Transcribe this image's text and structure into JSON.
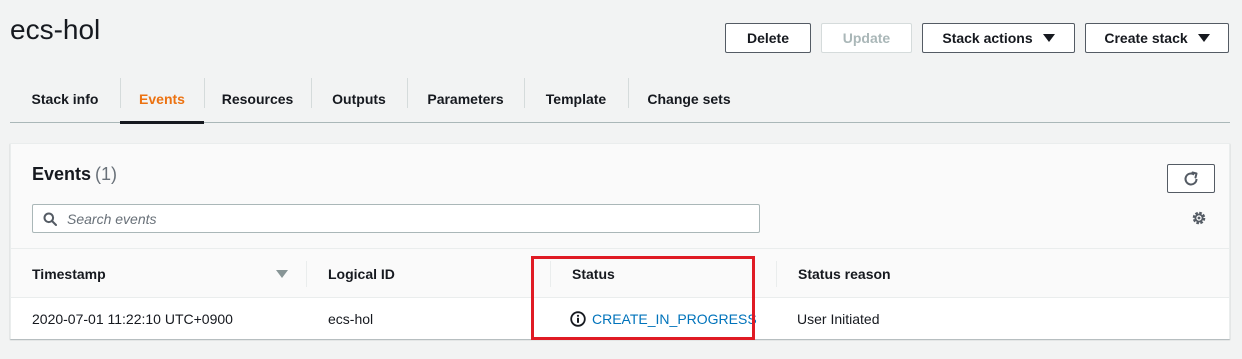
{
  "header": {
    "title": "ecs-hol",
    "buttons": {
      "delete": "Delete",
      "update": "Update",
      "stack_actions": "Stack actions",
      "create_stack": "Create stack"
    }
  },
  "tabs": [
    {
      "label": "Stack info",
      "active": false
    },
    {
      "label": "Events",
      "active": true
    },
    {
      "label": "Resources",
      "active": false
    },
    {
      "label": "Outputs",
      "active": false
    },
    {
      "label": "Parameters",
      "active": false
    },
    {
      "label": "Template",
      "active": false
    },
    {
      "label": "Change sets",
      "active": false
    }
  ],
  "events": {
    "title": "Events",
    "count": "(1)",
    "search_placeholder": "Search events",
    "columns": {
      "timestamp": "Timestamp",
      "logical_id": "Logical ID",
      "status": "Status",
      "status_reason": "Status reason"
    },
    "rows": [
      {
        "timestamp": "2020-07-01 11:22:10 UTC+0900",
        "logical_id": "ecs-hol",
        "status": "CREATE_IN_PROGRESS",
        "status_reason": "User Initiated"
      }
    ]
  },
  "colors": {
    "accent_tab": "#ec7211",
    "link": "#0073bb",
    "highlight": "#e01b24"
  },
  "icons": [
    "caret-down-icon",
    "refresh-icon",
    "search-icon",
    "gear-icon",
    "info-icon",
    "sort-caret-icon"
  ]
}
